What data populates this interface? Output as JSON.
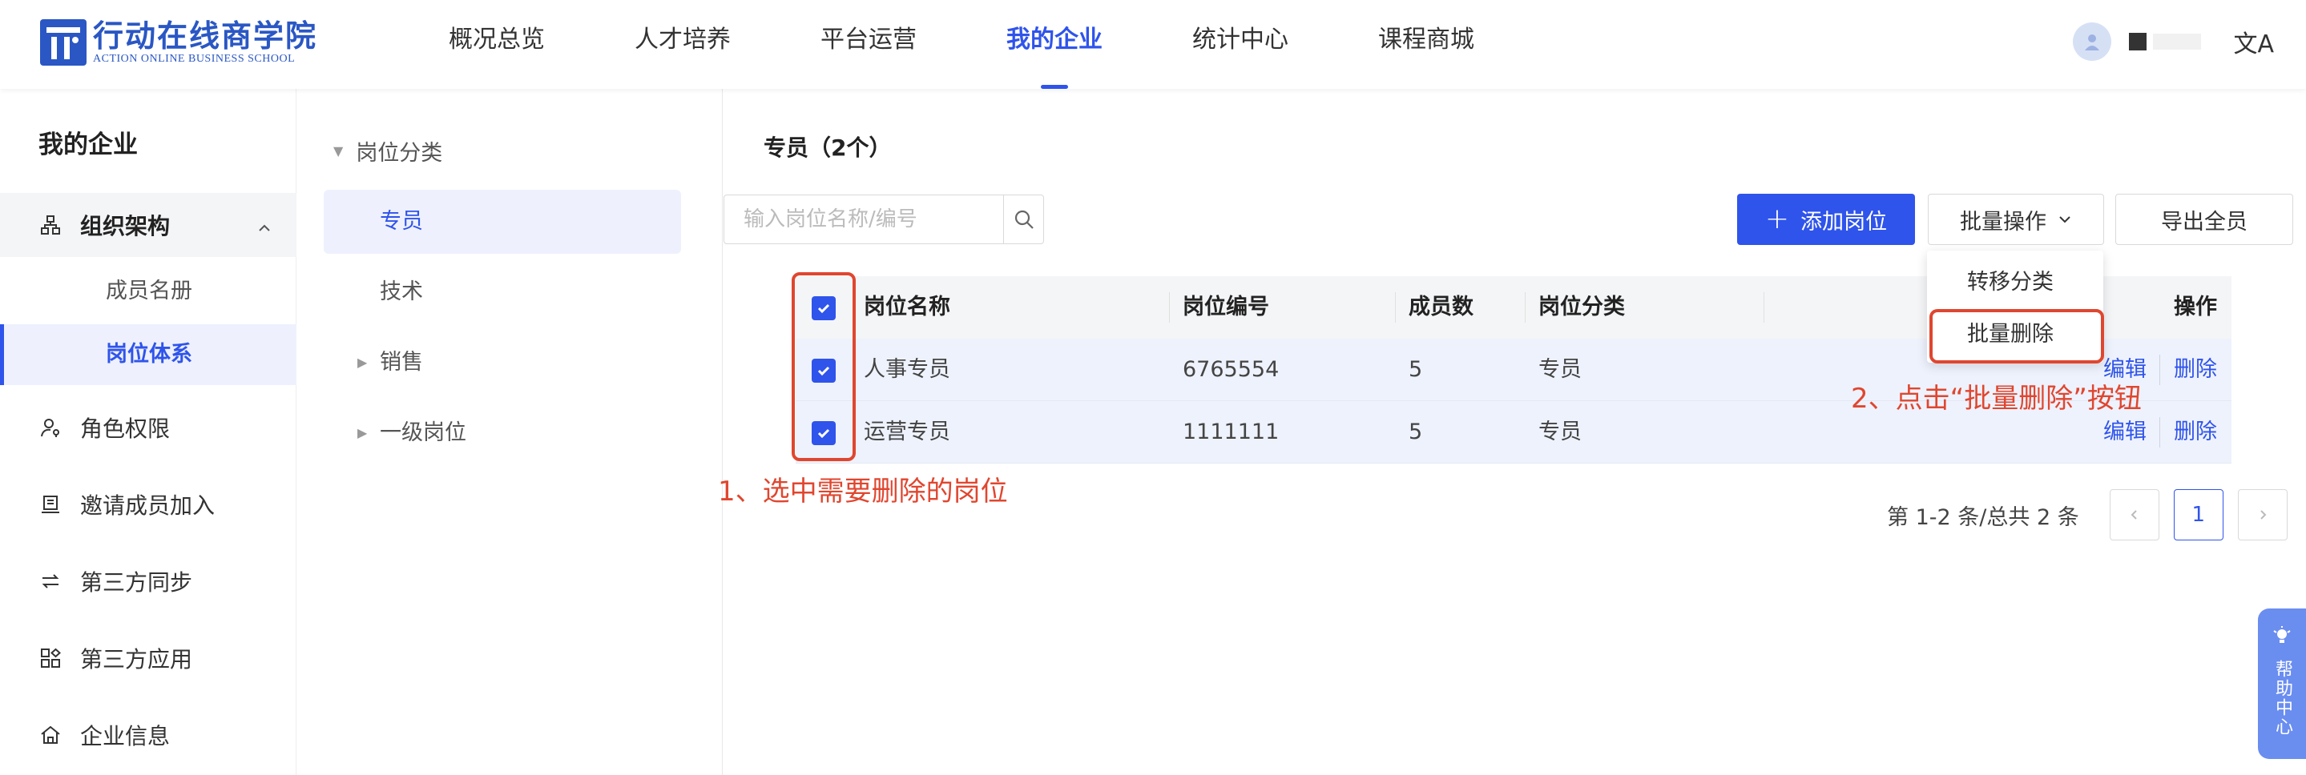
{
  "header": {
    "logo_cn": "行动在线商学院",
    "logo_en": "ACTION ONLINE BUSINESS SCHOOL",
    "nav": [
      "概况总览",
      "人才培养",
      "平台运营",
      "我的企业",
      "统计中心",
      "课程商城"
    ],
    "active_nav": "我的企业",
    "lang_icon": "文A"
  },
  "sidebar": {
    "title": "我的企业",
    "group_label": "组织架构",
    "sub_items": [
      "成员名册",
      "岗位体系"
    ],
    "items": [
      "角色权限",
      "邀请成员加入",
      "第三方同步",
      "第三方应用",
      "企业信息"
    ]
  },
  "tree": {
    "root": "岗位分类",
    "nodes": [
      "专员",
      "技术",
      "销售",
      "一级岗位"
    ]
  },
  "main": {
    "title": "专员（2个）",
    "search_placeholder": "输入岗位名称/编号",
    "add_button": "添加岗位",
    "batch_button": "批量操作",
    "export_button": "导出全员",
    "dropdown": [
      "转移分类",
      "批量删除"
    ],
    "columns": [
      "岗位名称",
      "岗位编号",
      "成员数",
      "岗位分类",
      "操作"
    ],
    "rows": [
      {
        "name": "人事专员",
        "code": "6765554",
        "count": "5",
        "category": "专员",
        "edit": "编辑",
        "delete": "删除"
      },
      {
        "name": "运营专员",
        "code": "1111111",
        "count": "5",
        "category": "专员",
        "edit": "编辑",
        "delete": "删除"
      }
    ],
    "pager_text": "第 1-2 条/总共 2 条",
    "current_page": "1"
  },
  "annotations": {
    "step1": "1、选中需要删除的岗位",
    "step2": "2、点击“批量删除”按钮"
  },
  "help": "帮助中心",
  "colors": {
    "primary": "#2f54eb",
    "annotation": "#e0462f",
    "help": "#6a8df0"
  }
}
